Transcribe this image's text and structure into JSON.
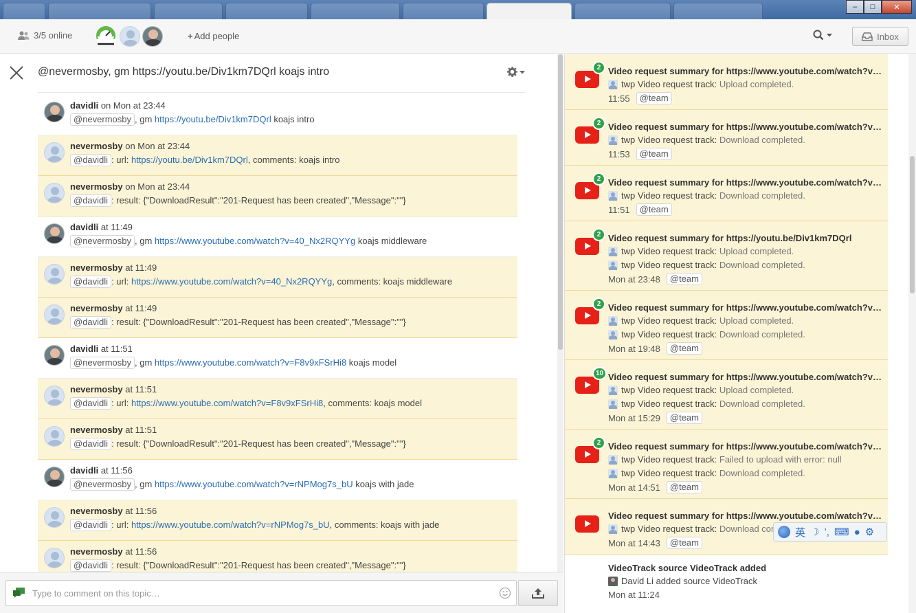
{
  "topbar": {
    "online_count": "3/5 online",
    "add_people": "Add people",
    "inbox_label": "Inbox"
  },
  "thread": {
    "title": "@nevermosby, gm https://youtu.be/Div1km7DQrl koajs intro",
    "messages": [
      {
        "author": "davidli",
        "time": "on Mon at 23:44",
        "mention": "@nevermosby",
        "pre": ", gm ",
        "link": "https://youtu.be/Div1km7DQrl",
        "post": " koajs intro",
        "highlight": false,
        "avatar": "photo"
      },
      {
        "author": "nevermosby",
        "time": "on Mon at 23:44",
        "mention": "@davidli",
        "pre": ": url: ",
        "link": "https://youtu.be/Div1km7DQrl",
        "post": ", comments: koajs intro",
        "highlight": true,
        "avatar": "generic"
      },
      {
        "author": "nevermosby",
        "time": "on Mon at 23:44",
        "mention": "@davidli",
        "pre": ": result: {\"DownloadResult\":\"201-Request has been created\",\"Message\":\"\"}",
        "link": "",
        "post": "",
        "highlight": true,
        "avatar": "generic"
      },
      {
        "author": "davidli",
        "time": "at 11:49",
        "mention": "@nevermosby",
        "pre": ", gm ",
        "link": "https://www.youtube.com/watch?v=40_Nx2RQYYg",
        "post": " koajs middleware",
        "highlight": false,
        "avatar": "photo"
      },
      {
        "author": "nevermosby",
        "time": "at 11:49",
        "mention": "@davidli",
        "pre": ": url: ",
        "link": "https://www.youtube.com/watch?v=40_Nx2RQYYg",
        "post": ", comments: koajs middleware",
        "highlight": true,
        "avatar": "generic"
      },
      {
        "author": "nevermosby",
        "time": "at 11:49",
        "mention": "@davidli",
        "pre": ": result: {\"DownloadResult\":\"201-Request has been created\",\"Message\":\"\"}",
        "link": "",
        "post": "",
        "highlight": true,
        "avatar": "generic"
      },
      {
        "author": "davidli",
        "time": "at 11:51",
        "mention": "@nevermosby",
        "pre": ", gm ",
        "link": "https://www.youtube.com/watch?v=F8v9xFSrHi8",
        "post": " koajs model",
        "highlight": false,
        "avatar": "photo"
      },
      {
        "author": "nevermosby",
        "time": "at 11:51",
        "mention": "@davidli",
        "pre": ": url: ",
        "link": "https://www.youtube.com/watch?v=F8v9xFSrHi8",
        "post": ", comments: koajs model",
        "highlight": true,
        "avatar": "generic"
      },
      {
        "author": "nevermosby",
        "time": "at 11:51",
        "mention": "@davidli",
        "pre": ": result: {\"DownloadResult\":\"201-Request has been created\",\"Message\":\"\"}",
        "link": "",
        "post": "",
        "highlight": true,
        "avatar": "generic"
      },
      {
        "author": "davidli",
        "time": "at 11:56",
        "mention": "@nevermosby",
        "pre": ", gm ",
        "link": "https://www.youtube.com/watch?v=rNPMog7s_bU",
        "post": " koajs with jade",
        "highlight": false,
        "avatar": "photo"
      },
      {
        "author": "nevermosby",
        "time": "at 11:56",
        "mention": "@davidli",
        "pre": ": url: ",
        "link": "https://www.youtube.com/watch?v=rNPMog7s_bU",
        "post": ", comments: koajs with jade",
        "highlight": true,
        "avatar": "generic"
      },
      {
        "author": "nevermosby",
        "time": "at 11:56",
        "mention": "@davidli",
        "pre": ": result: {\"DownloadResult\":\"201-Request has been created\",\"Message\":\"\"}",
        "link": "",
        "post": "",
        "highlight": true,
        "avatar": "generic"
      }
    ]
  },
  "comment": {
    "placeholder": "Type to comment on this topic…"
  },
  "notifications": [
    {
      "badge": "2",
      "title": "Video request summary for https://www.youtube.com/watch?v…",
      "lines": [
        {
          "who": "twp",
          "label": "Video request track:",
          "status": "Upload completed."
        }
      ],
      "time": "11:55",
      "tag": "@team"
    },
    {
      "badge": "2",
      "title": "Video request summary for https://www.youtube.com/watch?v…",
      "lines": [
        {
          "who": "twp",
          "label": "Video request track:",
          "status": "Download completed."
        }
      ],
      "time": "11:53",
      "tag": "@team"
    },
    {
      "badge": "2",
      "title": "Video request summary for https://www.youtube.com/watch?v…",
      "lines": [
        {
          "who": "twp",
          "label": "Video request track:",
          "status": "Download completed."
        }
      ],
      "time": "11:51",
      "tag": "@team"
    },
    {
      "badge": "2",
      "title": "Video request summary for https://youtu.be/Div1km7DQrl",
      "lines": [
        {
          "who": "twp",
          "label": "Video request track:",
          "status": "Upload completed."
        },
        {
          "who": "twp",
          "label": "Video request track:",
          "status": "Download completed."
        }
      ],
      "time": "Mon at 23:48",
      "tag": "@team"
    },
    {
      "badge": "2",
      "title": "Video request summary for https://www.youtube.com/watch?v…",
      "lines": [
        {
          "who": "twp",
          "label": "Video request track:",
          "status": "Upload completed."
        },
        {
          "who": "twp",
          "label": "Video request track:",
          "status": "Download completed."
        }
      ],
      "time": "Mon at 19:48",
      "tag": "@team"
    },
    {
      "badge": "10",
      "title": "Video request summary for https://www.youtube.com/watch?v…",
      "lines": [
        {
          "who": "twp",
          "label": "Video request track:",
          "status": "Upload completed."
        },
        {
          "who": "twp",
          "label": "Video request track:",
          "status": "Download completed."
        }
      ],
      "time": "Mon at 15:29",
      "tag": "@team"
    },
    {
      "badge": "2",
      "title": "Video request summary for https://www.youtube.com/watch?v…",
      "lines": [
        {
          "who": "twp",
          "label": "Video request track:",
          "status": "Failed to upload with error: null"
        },
        {
          "who": "twp",
          "label": "Video request track:",
          "status": "Download completed."
        }
      ],
      "time": "Mon at 14:51",
      "tag": "@team"
    },
    {
      "badge": "",
      "title": "Video request summary for https://www.youtube.com/watch?v…",
      "lines": [
        {
          "who": "twp",
          "label": "Video request track:",
          "status": "Download completed."
        }
      ],
      "time": "Mon at 14:43",
      "tag": "@team"
    }
  ],
  "last_notification": {
    "title": "VideoTrack source VideoTrack added",
    "line": "David Li added source VideoTrack",
    "time": "Mon at 11:24"
  },
  "ime": {
    "mode": "英"
  },
  "colors": {
    "highlight_bg": "#fcf4d6",
    "link": "#2a6db5",
    "badge": "#2fa14a",
    "youtube": "#e62117"
  }
}
